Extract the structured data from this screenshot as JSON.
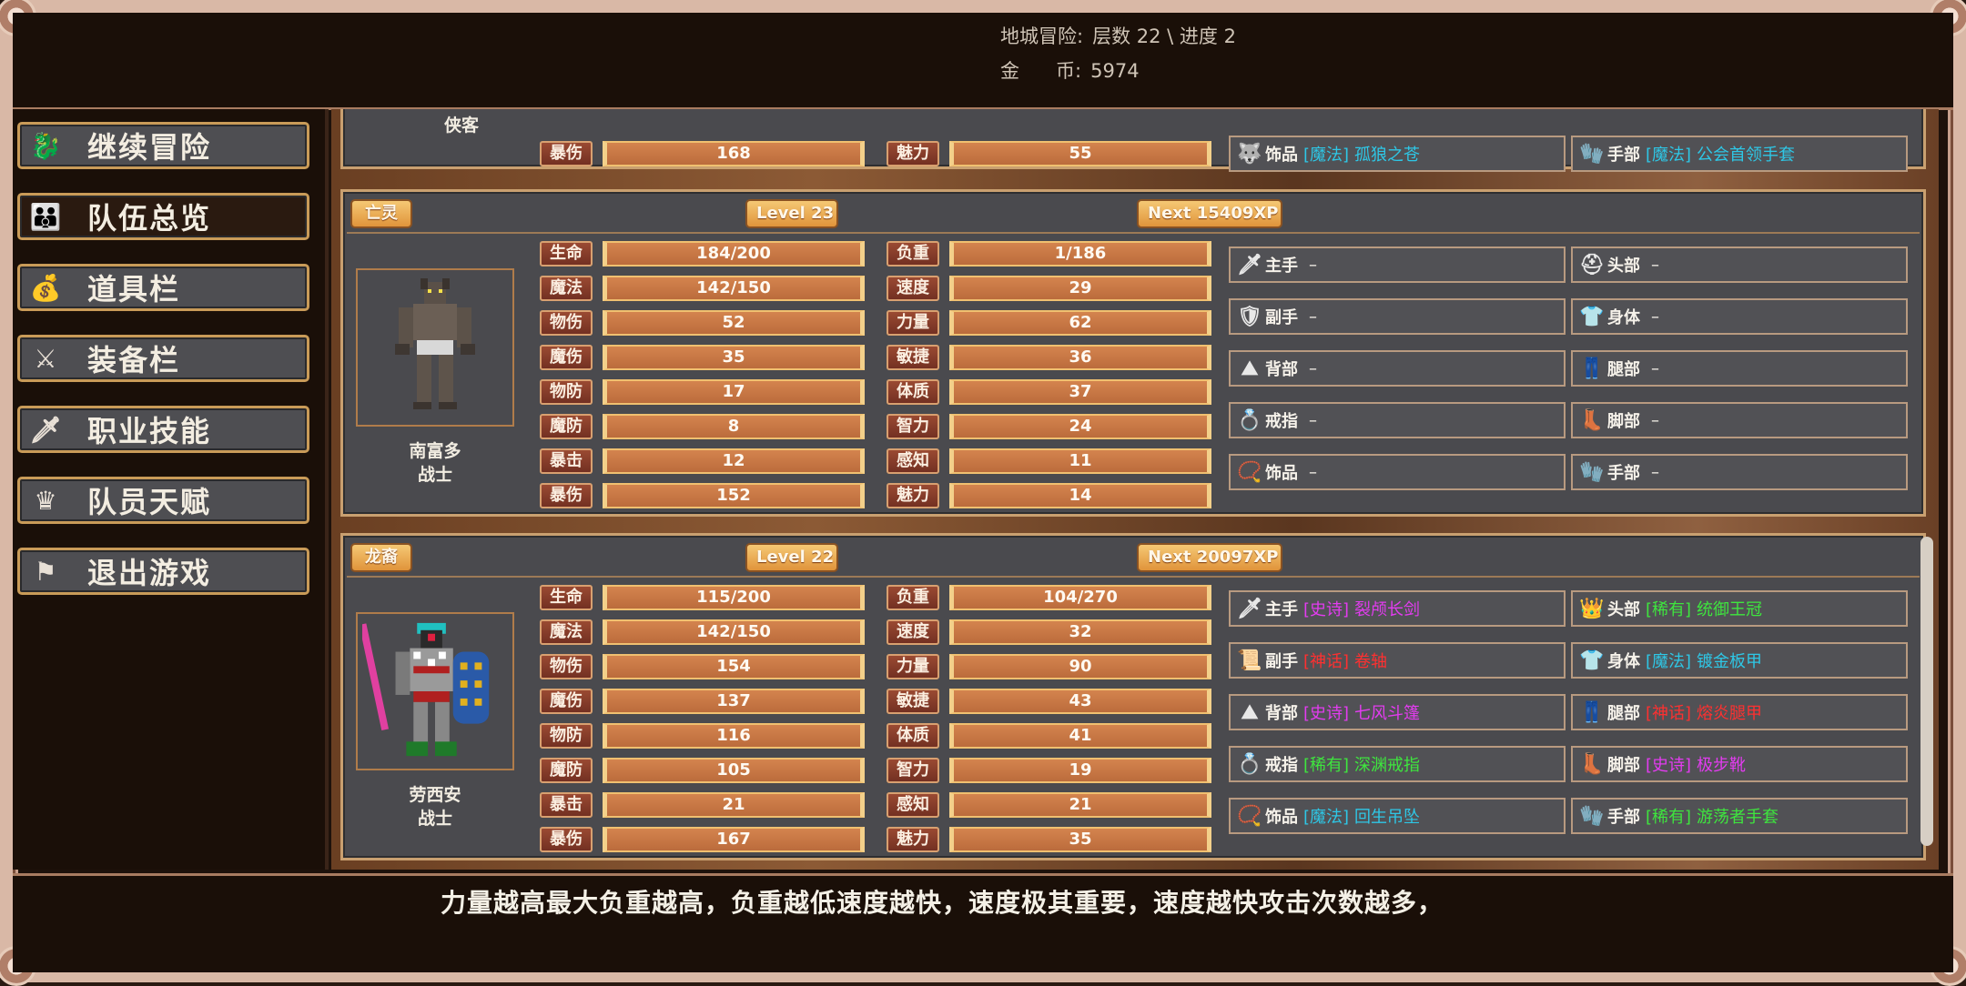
{
  "header": {
    "dungeon_label": "地城冒险:",
    "dungeon_value": "层数 22 \\ 进度 2",
    "gold_label": "金      币:",
    "gold_value": "5974"
  },
  "sidebar": {
    "items": [
      {
        "label": "继续冒险",
        "icon": "dragon-icon"
      },
      {
        "label": "队伍总览",
        "icon": "party-icon"
      },
      {
        "label": "道具栏",
        "icon": "bag-icon"
      },
      {
        "label": "装备栏",
        "icon": "weapons-icon"
      },
      {
        "label": "职业技能",
        "icon": "sword-wings-icon"
      },
      {
        "label": "队员天赋",
        "icon": "laurel-icon"
      },
      {
        "label": "退出游戏",
        "icon": "flag-icon"
      }
    ]
  },
  "panel0": {
    "cls_fragment": "侠客",
    "stats": [
      {
        "l1": "暴伤",
        "v1": "168",
        "l2": "魅力",
        "v2": "55"
      }
    ],
    "equip": [
      {
        "slot": "饰品",
        "tier": "[魔法]",
        "name": "孤狼之苍",
        "color": "#2ec7e6",
        "icon": "wolf-amulet-icon"
      },
      {
        "slot": "手部",
        "tier": "[魔法]",
        "name": "公会首领手套",
        "color": "#2ec7e6",
        "icon": "gloves-icon"
      }
    ]
  },
  "panel1": {
    "race": "亡灵",
    "level": "Level 23",
    "next": "Next 15409XP",
    "name": "南富多",
    "cls": "战士",
    "stats": [
      {
        "l1": "生命",
        "v1": "184/200",
        "l2": "负重",
        "v2": "1/186"
      },
      {
        "l1": "魔法",
        "v1": "142/150",
        "l2": "速度",
        "v2": "29"
      },
      {
        "l1": "物伤",
        "v1": "52",
        "l2": "力量",
        "v2": "62"
      },
      {
        "l1": "魔伤",
        "v1": "35",
        "l2": "敏捷",
        "v2": "36"
      },
      {
        "l1": "物防",
        "v1": "17",
        "l2": "体质",
        "v2": "37"
      },
      {
        "l1": "魔防",
        "v1": "8",
        "l2": "智力",
        "v2": "24"
      },
      {
        "l1": "暴击",
        "v1": "12",
        "l2": "感知",
        "v2": "11"
      },
      {
        "l1": "暴伤",
        "v1": "152",
        "l2": "魅力",
        "v2": "14"
      }
    ],
    "equip": [
      {
        "slot": "主手",
        "tier": "",
        "name": "–",
        "color": "#f6f2ea",
        "icon": "sword-icon"
      },
      {
        "slot": "头部",
        "tier": "",
        "name": "–",
        "color": "#f6f2ea",
        "icon": "helmet-icon"
      },
      {
        "slot": "副手",
        "tier": "",
        "name": "–",
        "color": "#f6f2ea",
        "icon": "shield-icon"
      },
      {
        "slot": "身体",
        "tier": "",
        "name": "–",
        "color": "#f6f2ea",
        "icon": "armor-icon"
      },
      {
        "slot": "背部",
        "tier": "",
        "name": "–",
        "color": "#f6f2ea",
        "icon": "cape-icon"
      },
      {
        "slot": "腿部",
        "tier": "",
        "name": "–",
        "color": "#f6f2ea",
        "icon": "legs-icon"
      },
      {
        "slot": "戒指",
        "tier": "",
        "name": "–",
        "color": "#f6f2ea",
        "icon": "ring-icon"
      },
      {
        "slot": "脚部",
        "tier": "",
        "name": "–",
        "color": "#f6f2ea",
        "icon": "boots-icon"
      },
      {
        "slot": "饰品",
        "tier": "",
        "name": "–",
        "color": "#f6f2ea",
        "icon": "necklace-icon"
      },
      {
        "slot": "手部",
        "tier": "",
        "name": "–",
        "color": "#f6f2ea",
        "icon": "gloves-icon"
      }
    ]
  },
  "panel2": {
    "race": "龙裔",
    "level": "Level 22",
    "next": "Next 20097XP",
    "name": "劳西安",
    "cls": "战士",
    "stats": [
      {
        "l1": "生命",
        "v1": "115/200",
        "l2": "负重",
        "v2": "104/270"
      },
      {
        "l1": "魔法",
        "v1": "142/150",
        "l2": "速度",
        "v2": "32"
      },
      {
        "l1": "物伤",
        "v1": "154",
        "l2": "力量",
        "v2": "90"
      },
      {
        "l1": "魔伤",
        "v1": "137",
        "l2": "敏捷",
        "v2": "43"
      },
      {
        "l1": "物防",
        "v1": "116",
        "l2": "体质",
        "v2": "41"
      },
      {
        "l1": "魔防",
        "v1": "105",
        "l2": "智力",
        "v2": "19"
      },
      {
        "l1": "暴击",
        "v1": "21",
        "l2": "感知",
        "v2": "21"
      },
      {
        "l1": "暴伤",
        "v1": "167",
        "l2": "魅力",
        "v2": "35"
      }
    ],
    "equip": [
      {
        "slot": "主手",
        "tier": "[史诗]",
        "name": "裂颅长剑",
        "color": "#e33cf0",
        "icon": "sword-icon"
      },
      {
        "slot": "头部",
        "tier": "[稀有]",
        "name": "统御王冠",
        "color": "#3ee63e",
        "icon": "crown-icon"
      },
      {
        "slot": "副手",
        "tier": "[神话]",
        "name": "卷轴",
        "color": "#ff3030",
        "icon": "scroll-icon"
      },
      {
        "slot": "身体",
        "tier": "[魔法]",
        "name": "镀金板甲",
        "color": "#2ec7e6",
        "icon": "armor-icon"
      },
      {
        "slot": "背部",
        "tier": "[史诗]",
        "name": "七风斗篷",
        "color": "#e33cf0",
        "icon": "cape-icon"
      },
      {
        "slot": "腿部",
        "tier": "[神话]",
        "name": "熔炎腿甲",
        "color": "#ff3030",
        "icon": "legs-icon"
      },
      {
        "slot": "戒指",
        "tier": "[稀有]",
        "name": "深渊戒指",
        "color": "#3ee63e",
        "icon": "ring-icon"
      },
      {
        "slot": "脚部",
        "tier": "[史诗]",
        "name": "极步靴",
        "color": "#e33cf0",
        "icon": "boots-icon"
      },
      {
        "slot": "饰品",
        "tier": "[魔法]",
        "name": "回生吊坠",
        "color": "#2ec7e6",
        "icon": "necklace-icon"
      },
      {
        "slot": "手部",
        "tier": "[稀有]",
        "name": "游荡者手套",
        "color": "#3ee63e",
        "icon": "gloves-icon"
      }
    ]
  },
  "footer": {
    "tip": "力量越高最大负重越高，负重越低速度越快，速度极其重要，速度越快攻击次数越多，"
  }
}
